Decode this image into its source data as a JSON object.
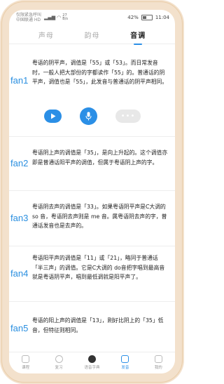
{
  "status": {
    "carrier1": "仅限紧急呼叫",
    "carrier2": "中国联通 HD",
    "net_speed": "27",
    "net_unit": "B/s",
    "battery": "42%",
    "time": "11:04"
  },
  "tabs": [
    {
      "label": "声母"
    },
    {
      "label": "韵母"
    },
    {
      "label": "音调",
      "active": true
    }
  ],
  "items": [
    {
      "label": "fan1",
      "text": "粤语的阴平声，调值是「55」或「53」。而日常发音时，一般人把大部份的字都读作「55」的。普通话的阴平声，调值也是「55」，此发音与普通话的阴平声相同。"
    },
    {
      "label": "fan2",
      "text": "粤语阴上声的调值是「35」，是向上升起的。这个调值亦即是普通话阳平声的调值，但属于粤语阴上声的字。"
    },
    {
      "label": "fan3",
      "text": "粤语阴去声的调值是「33」。如果粤语阴平声是C大调的 so 音，粤语阴去声则是 me 音。属粤语阴去声的字，普通话发音也是去声的。"
    },
    {
      "label": "fan4",
      "text": "粤语阳平声的调值是「11」或「21」，略同于普通话「半三声」的调值。它是C大调的 do音把字唱到最高音就是粤语阴平声，唱到最低调就是阳平声了。"
    },
    {
      "label": "fan5",
      "text": "粤语的阳上声的调值是「13」，刚好比阴上的「35」低音，但特征则相同。"
    }
  ],
  "controls": {
    "play_icon": "play-icon",
    "mic_icon": "mic-icon",
    "more_icon": "more-icon",
    "more_glyph": "•••"
  },
  "tabbar": [
    {
      "label": "课程",
      "icon": "book-icon"
    },
    {
      "label": "复习",
      "icon": "review-icon"
    },
    {
      "label": "语音字典",
      "icon": "voice-dict-icon"
    },
    {
      "label": "发音",
      "icon": "pronounce-icon",
      "active": true
    },
    {
      "label": "我的",
      "icon": "profile-icon"
    }
  ],
  "colors": {
    "accent": "#2b8fe6",
    "frame": "#f3e1cc"
  }
}
